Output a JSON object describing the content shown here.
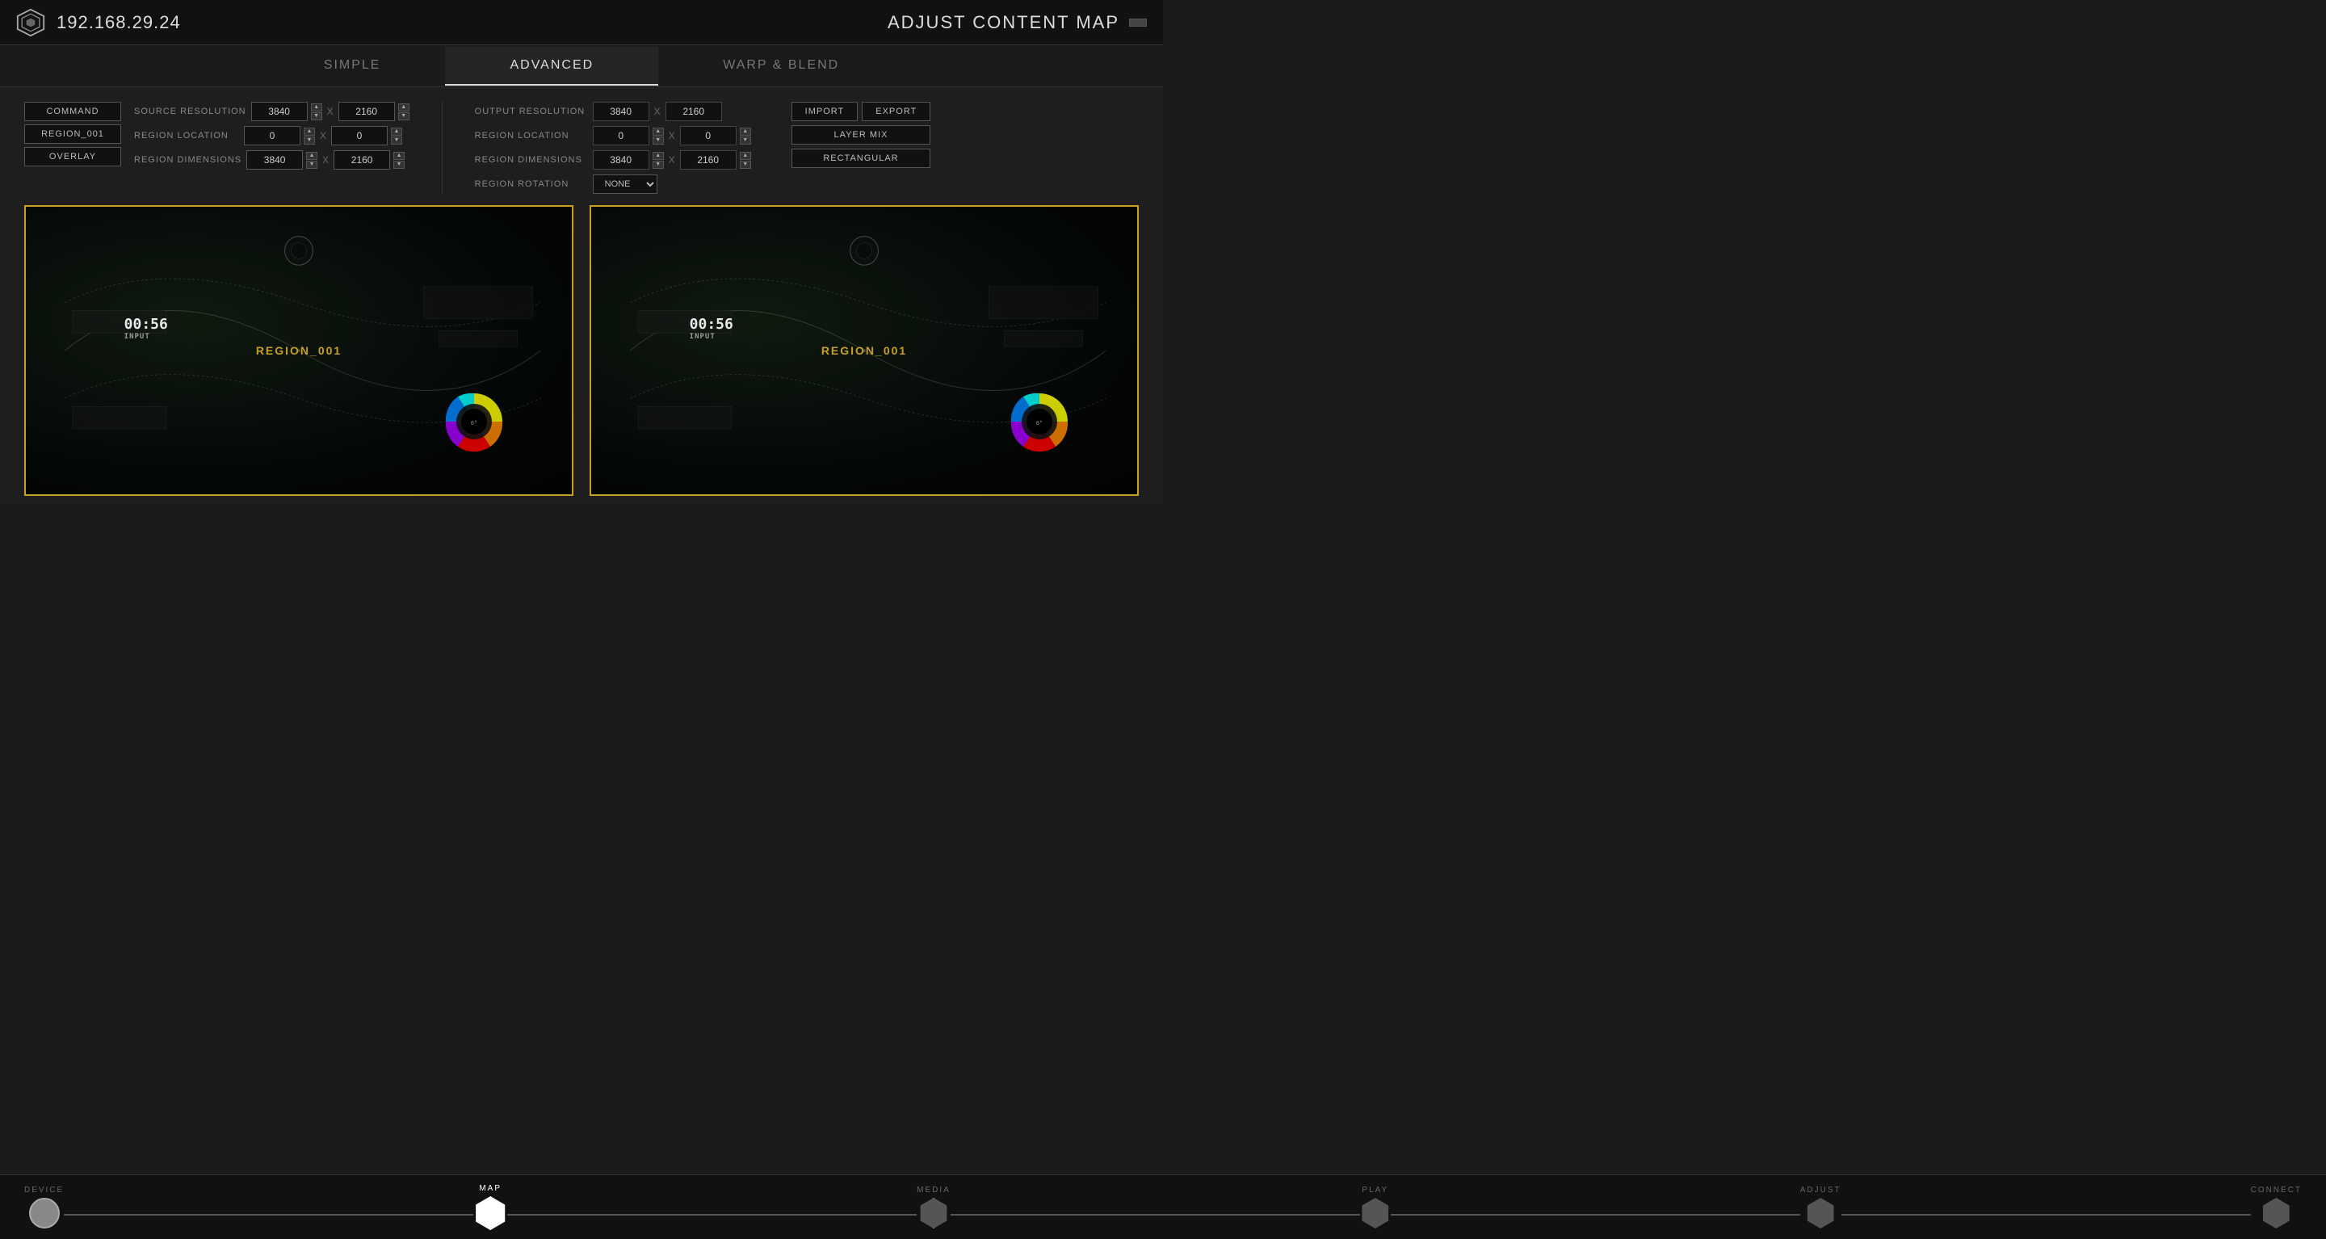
{
  "header": {
    "ip": "192.168.29.24",
    "title": "ADJUST CONTENT MAP",
    "btn_label": ""
  },
  "tabs": [
    {
      "id": "simple",
      "label": "SIMPLE",
      "active": false
    },
    {
      "id": "advanced",
      "label": "ADVANCED",
      "active": true
    },
    {
      "id": "warp",
      "label": "WARP & BLEND",
      "active": false
    }
  ],
  "left": {
    "commands": [
      {
        "id": "command",
        "label": "COMMAND"
      },
      {
        "id": "region",
        "label": "REGION_001"
      },
      {
        "id": "overlay",
        "label": "OVERLAY"
      }
    ],
    "fields": [
      {
        "label": "SOURCE RESOLUTION",
        "x_val": "3840",
        "y_val": "2160"
      },
      {
        "label": "REGION LOCATION",
        "x_val": "0",
        "y_val": "0"
      },
      {
        "label": "REGION DIMENSIONS",
        "x_val": "3840",
        "y_val": "2160"
      }
    ]
  },
  "right": {
    "fields": [
      {
        "label": "OUTPUT RESOLUTION",
        "x_val": "3840",
        "y_val": "2160",
        "has_spinner": false
      },
      {
        "label": "REGION LOCATION",
        "x_val": "0",
        "y_val": "0",
        "has_spinner": true
      },
      {
        "label": "REGION DIMENSIONS",
        "x_val": "3840",
        "y_val": "2160",
        "has_spinner": true
      },
      {
        "label": "REGION ROTATION",
        "rotation_val": "NONE",
        "is_rotation": true
      }
    ],
    "action_buttons": [
      [
        "IMPORT",
        "EXPORT"
      ],
      [
        "LAYER MIX"
      ],
      [
        "RECTANGULAR"
      ]
    ]
  },
  "previews": [
    {
      "region_label": "REGION_001",
      "timer": "00:56"
    },
    {
      "region_label": "REGION_001",
      "timer": "00:56"
    }
  ],
  "bottom_nav": {
    "items": [
      {
        "id": "device",
        "label": "DEVICE",
        "shape": "circle",
        "active": false
      },
      {
        "id": "map",
        "label": "MAP",
        "shape": "hex-white",
        "active": true
      },
      {
        "id": "media",
        "label": "MEDIA",
        "shape": "diamond",
        "active": false
      },
      {
        "id": "play",
        "label": "PLAY",
        "shape": "diamond",
        "active": false
      },
      {
        "id": "adjust",
        "label": "ADJUST",
        "shape": "diamond",
        "active": false
      },
      {
        "id": "connect",
        "label": "CONNECT",
        "shape": "diamond",
        "active": false
      }
    ]
  }
}
